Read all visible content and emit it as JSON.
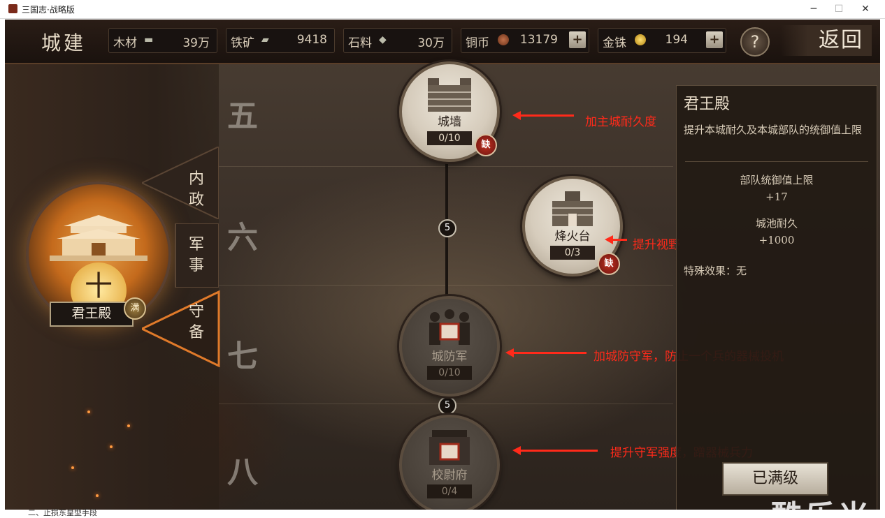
{
  "window": {
    "title": "三国志·战略版",
    "min": "─",
    "max": "☐",
    "close": "✕"
  },
  "topbar": {
    "heading": "城建",
    "resources": [
      {
        "label": "木材",
        "value": "39万",
        "icon": "wood-icon"
      },
      {
        "label": "铁矿",
        "value": "9418",
        "icon": "iron-icon"
      },
      {
        "label": "石料",
        "value": "30万",
        "icon": "stone-icon"
      },
      {
        "label": "铜币",
        "value": "13179",
        "icon": "copper-coin-icon",
        "plus": "+"
      },
      {
        "label": "金铢",
        "value": "194",
        "icon": "gold-coin-icon",
        "plus": "+"
      }
    ],
    "help": "?",
    "back": "返回"
  },
  "main_building": {
    "level": "十",
    "name": "君王殿",
    "badge": "满"
  },
  "tabs": [
    {
      "label": "内政",
      "active": false
    },
    {
      "label": "军事",
      "active": false
    },
    {
      "label": "守备",
      "active": true
    }
  ],
  "rows": [
    "五",
    "六",
    "七",
    "八"
  ],
  "nodes": [
    {
      "name": "城墙",
      "progress": "0/10",
      "lack": "缺"
    },
    {
      "name": "烽火台",
      "progress": "0/3",
      "lack": "缺"
    },
    {
      "name": "城防军",
      "progress": "0/10"
    },
    {
      "name": "校尉府",
      "progress": "0/4"
    }
  ],
  "costs": [
    "5",
    "5"
  ],
  "annotations": [
    "加主城耐久度",
    "提升视野",
    "加城防守军，防止一个兵的器械投机",
    "提升守军强度，蹭器械兵力"
  ],
  "info": {
    "title": "君王殿",
    "desc": "提升本城耐久及本城部队的统御值上限",
    "stats": [
      {
        "label": "部队统御值上限",
        "value": "+17"
      },
      {
        "label": "城池耐久",
        "value": "+1000"
      }
    ],
    "special": "特殊效果：无",
    "button": "已满级"
  },
  "watermark": "酷乐米",
  "footer_text": "二、止损东皇型手段",
  "colors": {
    "annotation": "#ff2a1a",
    "accent": "#e0a030"
  }
}
